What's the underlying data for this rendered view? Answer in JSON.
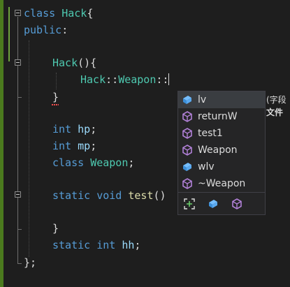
{
  "code": {
    "l1": {
      "kw": "class",
      "name": "Hack",
      "punct": "{"
    },
    "l2": {
      "kw": "public",
      "punct": ":"
    },
    "l4": {
      "fn": "Hack",
      "punct": "(){"
    },
    "l5": {
      "scope1": "Hack",
      "sep1": "::",
      "scope2": "Weapon",
      "sep2": "::"
    },
    "l6": {
      "punct": "}"
    },
    "l8": {
      "kw": "int",
      "var": "hp",
      "punct": ";"
    },
    "l9": {
      "kw": "int",
      "var": "mp",
      "punct": ";"
    },
    "l10": {
      "kw": "class",
      "name": "Weapon",
      "punct": ";"
    },
    "l12": {
      "kw1": "static",
      "kw2": "void",
      "fn": "test",
      "punct": "()"
    },
    "l14": {
      "punct": "}"
    },
    "l15": {
      "kw1": "static",
      "kw2": "int",
      "var": "hh",
      "punct": ";"
    },
    "l16": {
      "punct": "};"
    }
  },
  "completion": {
    "items": [
      {
        "label": "lv",
        "icon": "field-icon"
      },
      {
        "label": "returnW",
        "icon": "method-icon"
      },
      {
        "label": "test1",
        "icon": "method-icon"
      },
      {
        "label": "Weapon",
        "icon": "class-icon"
      },
      {
        "label": "wlv",
        "icon": "field-icon"
      },
      {
        "label": "~Weapon",
        "icon": "method-icon"
      }
    ],
    "filters": [
      "expand-scope-icon",
      "field-filter-icon",
      "method-filter-icon"
    ],
    "tooltip": {
      "line1": "(字段",
      "line2": "文件"
    }
  },
  "colors": {
    "background": "#1e1e1e",
    "keyword": "#569cd6",
    "class": "#4ec9b0",
    "function": "#dcdcaa",
    "variable": "#9cdcfe",
    "field_icon": "#75beff",
    "method_icon": "#b180d7"
  }
}
